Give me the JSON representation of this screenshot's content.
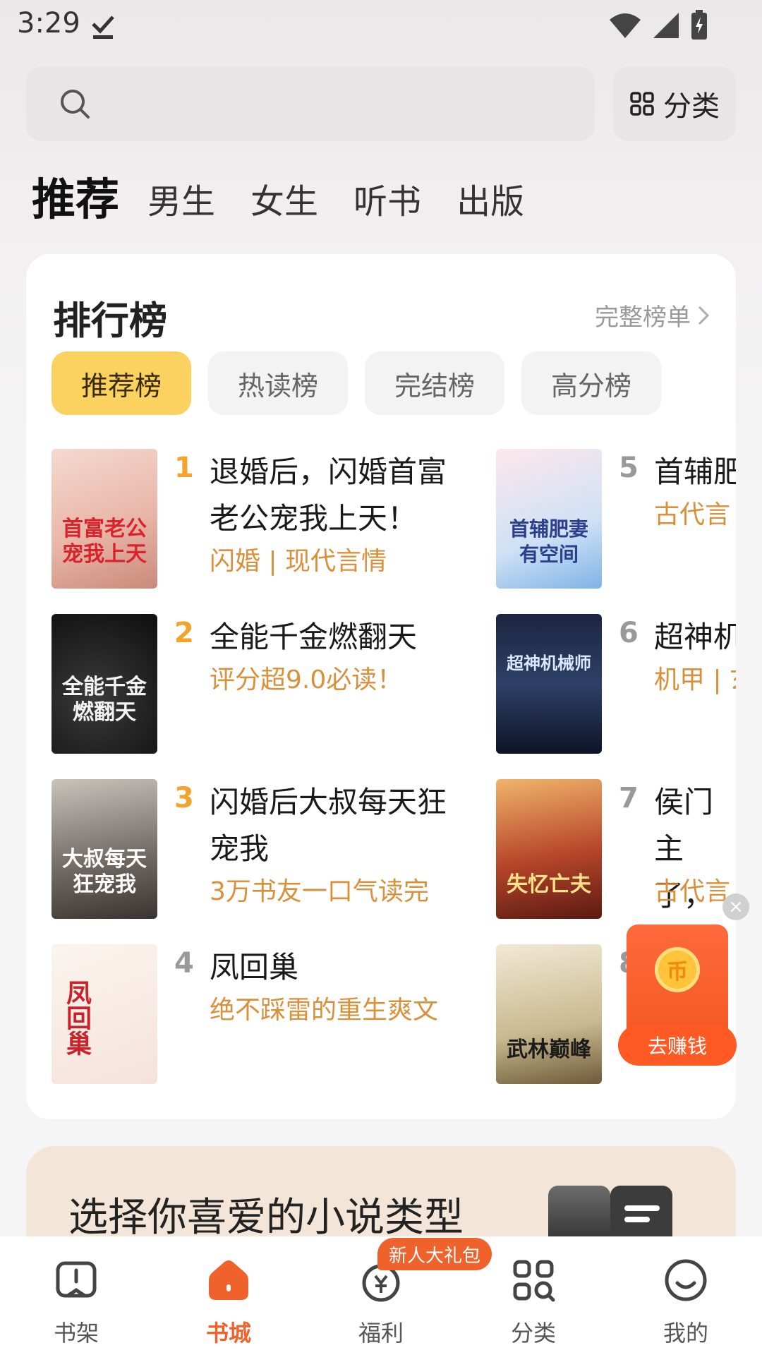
{
  "status": {
    "time": "3:29"
  },
  "search": {
    "placeholder": ""
  },
  "category_button": {
    "label": "分类"
  },
  "tabs": [
    "推荐",
    "男生",
    "女生",
    "听书",
    "出版"
  ],
  "ranking": {
    "title": "排行榜",
    "more_label": "完整榜单",
    "pills": [
      "推荐榜",
      "热读榜",
      "完结榜",
      "高分榜"
    ],
    "books": [
      {
        "rank": "1",
        "title": "退婚后，闪婚首富老公宠我上天！",
        "tag": "闪婚 | 现代言情",
        "cover_text": "首富老公宠我上天"
      },
      {
        "rank": "2",
        "title": "全能千金燃翻天",
        "tag": "评分超9.0必读！",
        "cover_text": "全能千金燃翻天"
      },
      {
        "rank": "3",
        "title": "闪婚后大叔每天狂宠我",
        "tag": "3万书友一口气读完",
        "cover_text": "大叔每天狂宠我"
      },
      {
        "rank": "4",
        "title": "凤回巢",
        "tag": "绝不踩雷的重生爽文",
        "cover_text": "凤回巢"
      },
      {
        "rank": "5",
        "title": "首辅肥",
        "tag": "古代言",
        "cover_text": "首辅肥妻有空间"
      },
      {
        "rank": "6",
        "title": "超神机",
        "tag": "机甲 | 玄",
        "cover_text": "超神机械师"
      },
      {
        "rank": "7",
        "title": "侯门主了，失",
        "tag": "古代言",
        "cover_text": "失忆亡夫"
      },
      {
        "rank": "8",
        "title": "",
        "tag": "",
        "cover_text": "武林巅峰"
      }
    ]
  },
  "genre_banner": {
    "title": "选择你喜爱的小说类型"
  },
  "reward": {
    "button_label": "去赚钱"
  },
  "bottom_nav": {
    "badge": "新人大礼包",
    "items": [
      {
        "label": "书架",
        "icon": "bookshelf-icon"
      },
      {
        "label": "书城",
        "icon": "bookstore-icon"
      },
      {
        "label": "福利",
        "icon": "welfare-icon"
      },
      {
        "label": "分类",
        "icon": "category-icon"
      },
      {
        "label": "我的",
        "icon": "profile-icon"
      }
    ]
  },
  "colors": {
    "accent": "#f0622b",
    "pill_active": "#fbd25f",
    "tag": "#d8903a"
  }
}
